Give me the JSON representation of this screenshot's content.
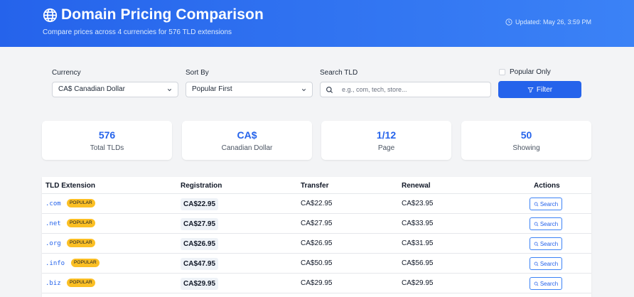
{
  "header": {
    "title": "Domain Pricing Comparison",
    "subtitle": "Compare prices across 4 currencies for 576 TLD extensions",
    "updated": "Updated: May 26, 3:59 PM"
  },
  "filters": {
    "currency_label": "Currency",
    "currency_value": "CA$ Canadian Dollar",
    "sort_label": "Sort By",
    "sort_value": "Popular First",
    "search_label": "Search TLD",
    "search_placeholder": "e.g., com, tech, store...",
    "search_value": "",
    "popular_only_label": "Popular Only",
    "popular_only_checked": false,
    "filter_button": "Filter"
  },
  "stats": [
    {
      "value": "576",
      "label": "Total TLDs"
    },
    {
      "value": "CA$",
      "label": "Canadian Dollar"
    },
    {
      "value": "1/12",
      "label": "Page"
    },
    {
      "value": "50",
      "label": "Showing"
    }
  ],
  "table": {
    "columns": [
      "TLD Extension",
      "Registration",
      "Transfer",
      "Renewal",
      "Actions"
    ],
    "rows": [
      {
        "tld": ".com",
        "badge": "POPULAR",
        "registration": "CA$22.95",
        "transfer": "CA$22.95",
        "renewal": "CA$23.95",
        "action": "Search"
      },
      {
        "tld": ".net",
        "badge": "POPULAR",
        "registration": "CA$27.95",
        "transfer": "CA$27.95",
        "renewal": "CA$33.95",
        "action": "Search"
      },
      {
        "tld": ".org",
        "badge": "POPULAR",
        "registration": "CA$26.95",
        "transfer": "CA$26.95",
        "renewal": "CA$31.95",
        "action": "Search"
      },
      {
        "tld": ".info",
        "badge": "POPULAR",
        "registration": "CA$47.95",
        "transfer": "CA$50.95",
        "renewal": "CA$56.95",
        "action": "Search"
      },
      {
        "tld": ".biz",
        "badge": "POPULAR",
        "registration": "CA$29.95",
        "transfer": "CA$29.95",
        "renewal": "CA$29.95",
        "action": "Search"
      }
    ]
  },
  "colors": {
    "accent": "#2563eb",
    "badge": "#fbbf24",
    "header_gradient_start": "#2563eb",
    "header_gradient_end": "#3b82f6"
  },
  "icons": [
    "globe-icon",
    "clock-icon",
    "chevron-down-icon",
    "search-icon",
    "filter-icon"
  ]
}
